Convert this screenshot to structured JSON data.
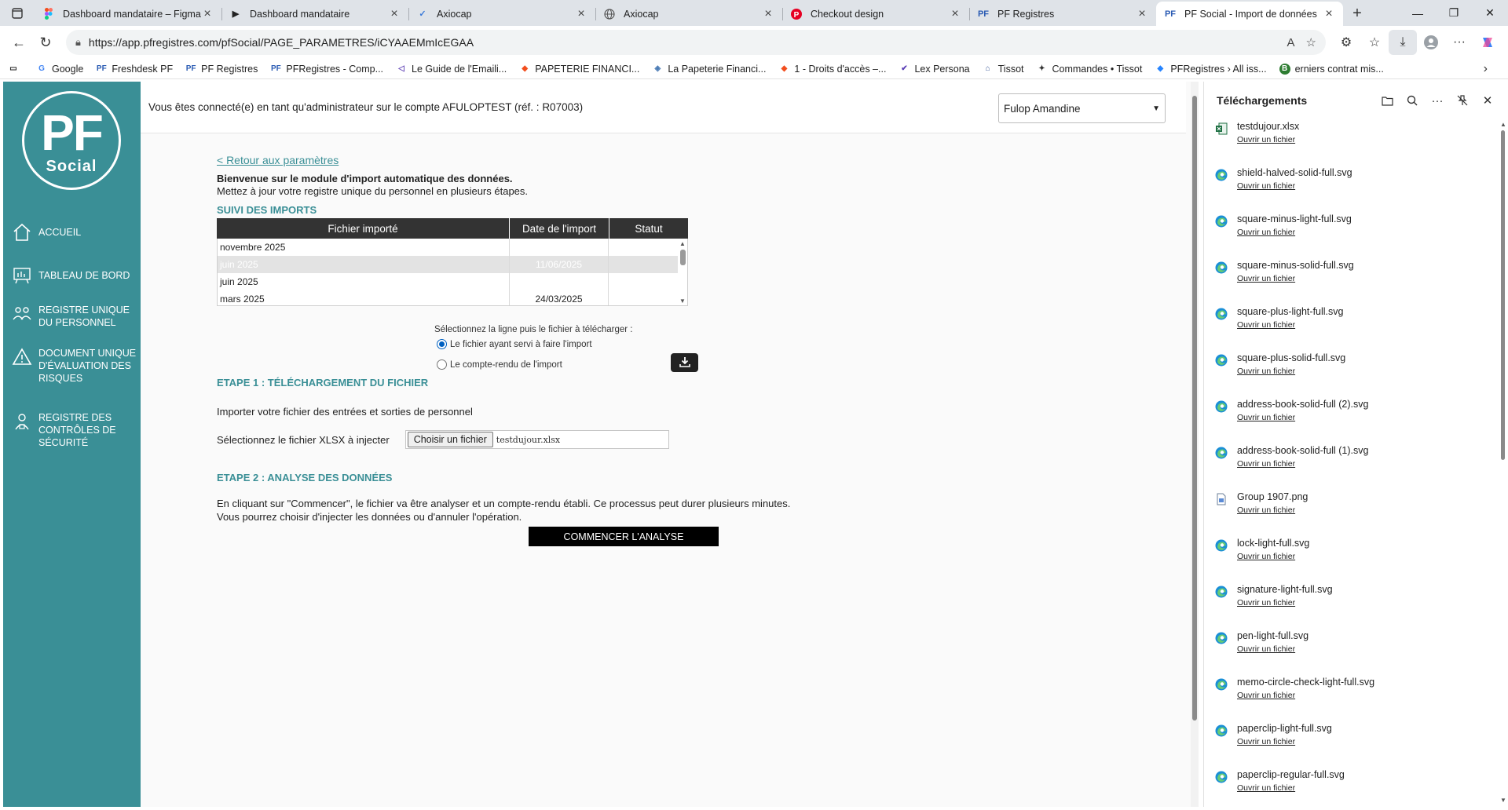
{
  "browser": {
    "tabs": [
      {
        "title": "Dashboard mandataire – Figma",
        "icon": "figma-icon"
      },
      {
        "title": "Dashboard mandataire",
        "icon": "play-icon"
      },
      {
        "title": "Axiocap",
        "icon": "axiocap-icon"
      },
      {
        "title": "Axiocap",
        "icon": "globe-icon"
      },
      {
        "title": "Checkout design",
        "icon": "pinterest-icon"
      },
      {
        "title": "PF Registres",
        "icon": "pf-icon"
      },
      {
        "title": "PF Social - Import de données",
        "icon": "pf-icon",
        "active": true
      }
    ],
    "url": "https://app.pfregistres.com/pfSocial/PAGE_PARAMETRES/iCYAAEMmIcEGAA",
    "bookmarks": [
      "Google",
      "Freshdesk PF",
      "PF Registres",
      "PFRegistres - Comp...",
      "Le Guide de l'Emaili...",
      "PAPETERIE FINANCI...",
      "La Papeterie Financi...",
      "1 - Droits d'accès –...",
      "Lex Persona",
      "Tissot",
      "Commandes • Tissot",
      "PFRegistres › All iss...",
      "erniers contrat mis..."
    ]
  },
  "sidebar": {
    "logo_top": "PF",
    "logo_bottom": "Social",
    "items": [
      {
        "label": "ACCUEIL",
        "icon": "home-icon"
      },
      {
        "label": "TABLEAU DE BORD",
        "icon": "dashboard-icon"
      },
      {
        "label": "REGISTRE UNIQUE DU PERSONNEL",
        "icon": "people-icon"
      },
      {
        "label": "DOCUMENT UNIQUE D'ÉVALUATION DES RISQUES",
        "icon": "warning-icon"
      },
      {
        "label": "REGISTRE DES CONTRÔLES DE SÉCURITÉ",
        "icon": "security-icon"
      }
    ]
  },
  "header": {
    "connected_text": "Vous êtes connecté(e) en tant qu'administrateur sur le compte AFULOPTEST (réf. : R07003)",
    "user_select": "Fulop Amandine"
  },
  "main": {
    "back_link": "< Retour aux paramètres",
    "welcome_title": "Bienvenue sur le module d'import automatique des données.",
    "welcome_text": "Mettez à jour votre registre unique du personnel en plusieurs étapes.",
    "suivi_title": "SUIVI DES IMPORTS",
    "table": {
      "headers": [
        "Fichier importé",
        "Date de l'import",
        "Statut"
      ],
      "rows": [
        {
          "file": "novembre 2025",
          "date": "",
          "status": ""
        },
        {
          "file": "juin 2025",
          "date": "11/06/2025",
          "status": "",
          "selected": true
        },
        {
          "file": "juin 2025",
          "date": "",
          "status": ""
        },
        {
          "file": "mars 2025",
          "date": "24/03/2025",
          "status": ""
        }
      ]
    },
    "select_hint": "Sélectionnez la ligne puis le fichier à télécharger :",
    "radio_1": "Le fichier ayant servi à faire l'import",
    "radio_2": "Le compte-rendu de l'import",
    "step1_title": "ETAPE 1 : TÉLÉCHARGEMENT DU FICHIER",
    "step1_text": "Importer votre fichier des entrées et sorties de personnel",
    "file_label": "Sélectionnez le fichier XLSX à injecter",
    "file_button": "Choisir un fichier",
    "file_name": "testdujour.xlsx",
    "step2_title": "ETAPE 2 : ANALYSE DES DONNÉES",
    "step2_text_1": "En cliquant sur \"Commencer\", le fichier va être analyser et un compte-rendu établi. Ce processus peut durer plusieurs minutes.",
    "step2_text_2": "Vous pourrez choisir d'injecter les données ou d'annuler l'opération.",
    "start_button": "COMMENCER L'ANALYSE"
  },
  "downloads": {
    "title": "Téléchargements",
    "open_label": "Ouvrir un fichier",
    "items": [
      {
        "name": "testdujour.xlsx",
        "type": "excel"
      },
      {
        "name": "shield-halved-solid-full.svg",
        "type": "edge"
      },
      {
        "name": "square-minus-light-full.svg",
        "type": "edge"
      },
      {
        "name": "square-minus-solid-full.svg",
        "type": "edge"
      },
      {
        "name": "square-plus-light-full.svg",
        "type": "edge"
      },
      {
        "name": "square-plus-solid-full.svg",
        "type": "edge"
      },
      {
        "name": "address-book-solid-full (2).svg",
        "type": "edge"
      },
      {
        "name": "address-book-solid-full (1).svg",
        "type": "edge"
      },
      {
        "name": "Group 1907.png",
        "type": "image"
      },
      {
        "name": "lock-light-full.svg",
        "type": "edge"
      },
      {
        "name": "signature-light-full.svg",
        "type": "edge"
      },
      {
        "name": "pen-light-full.svg",
        "type": "edge"
      },
      {
        "name": "memo-circle-check-light-full.svg",
        "type": "edge"
      },
      {
        "name": "paperclip-light-full.svg",
        "type": "edge"
      },
      {
        "name": "paperclip-regular-full.svg",
        "type": "edge"
      }
    ]
  },
  "colors": {
    "teal": "#3a8f96",
    "dark": "#333333"
  }
}
